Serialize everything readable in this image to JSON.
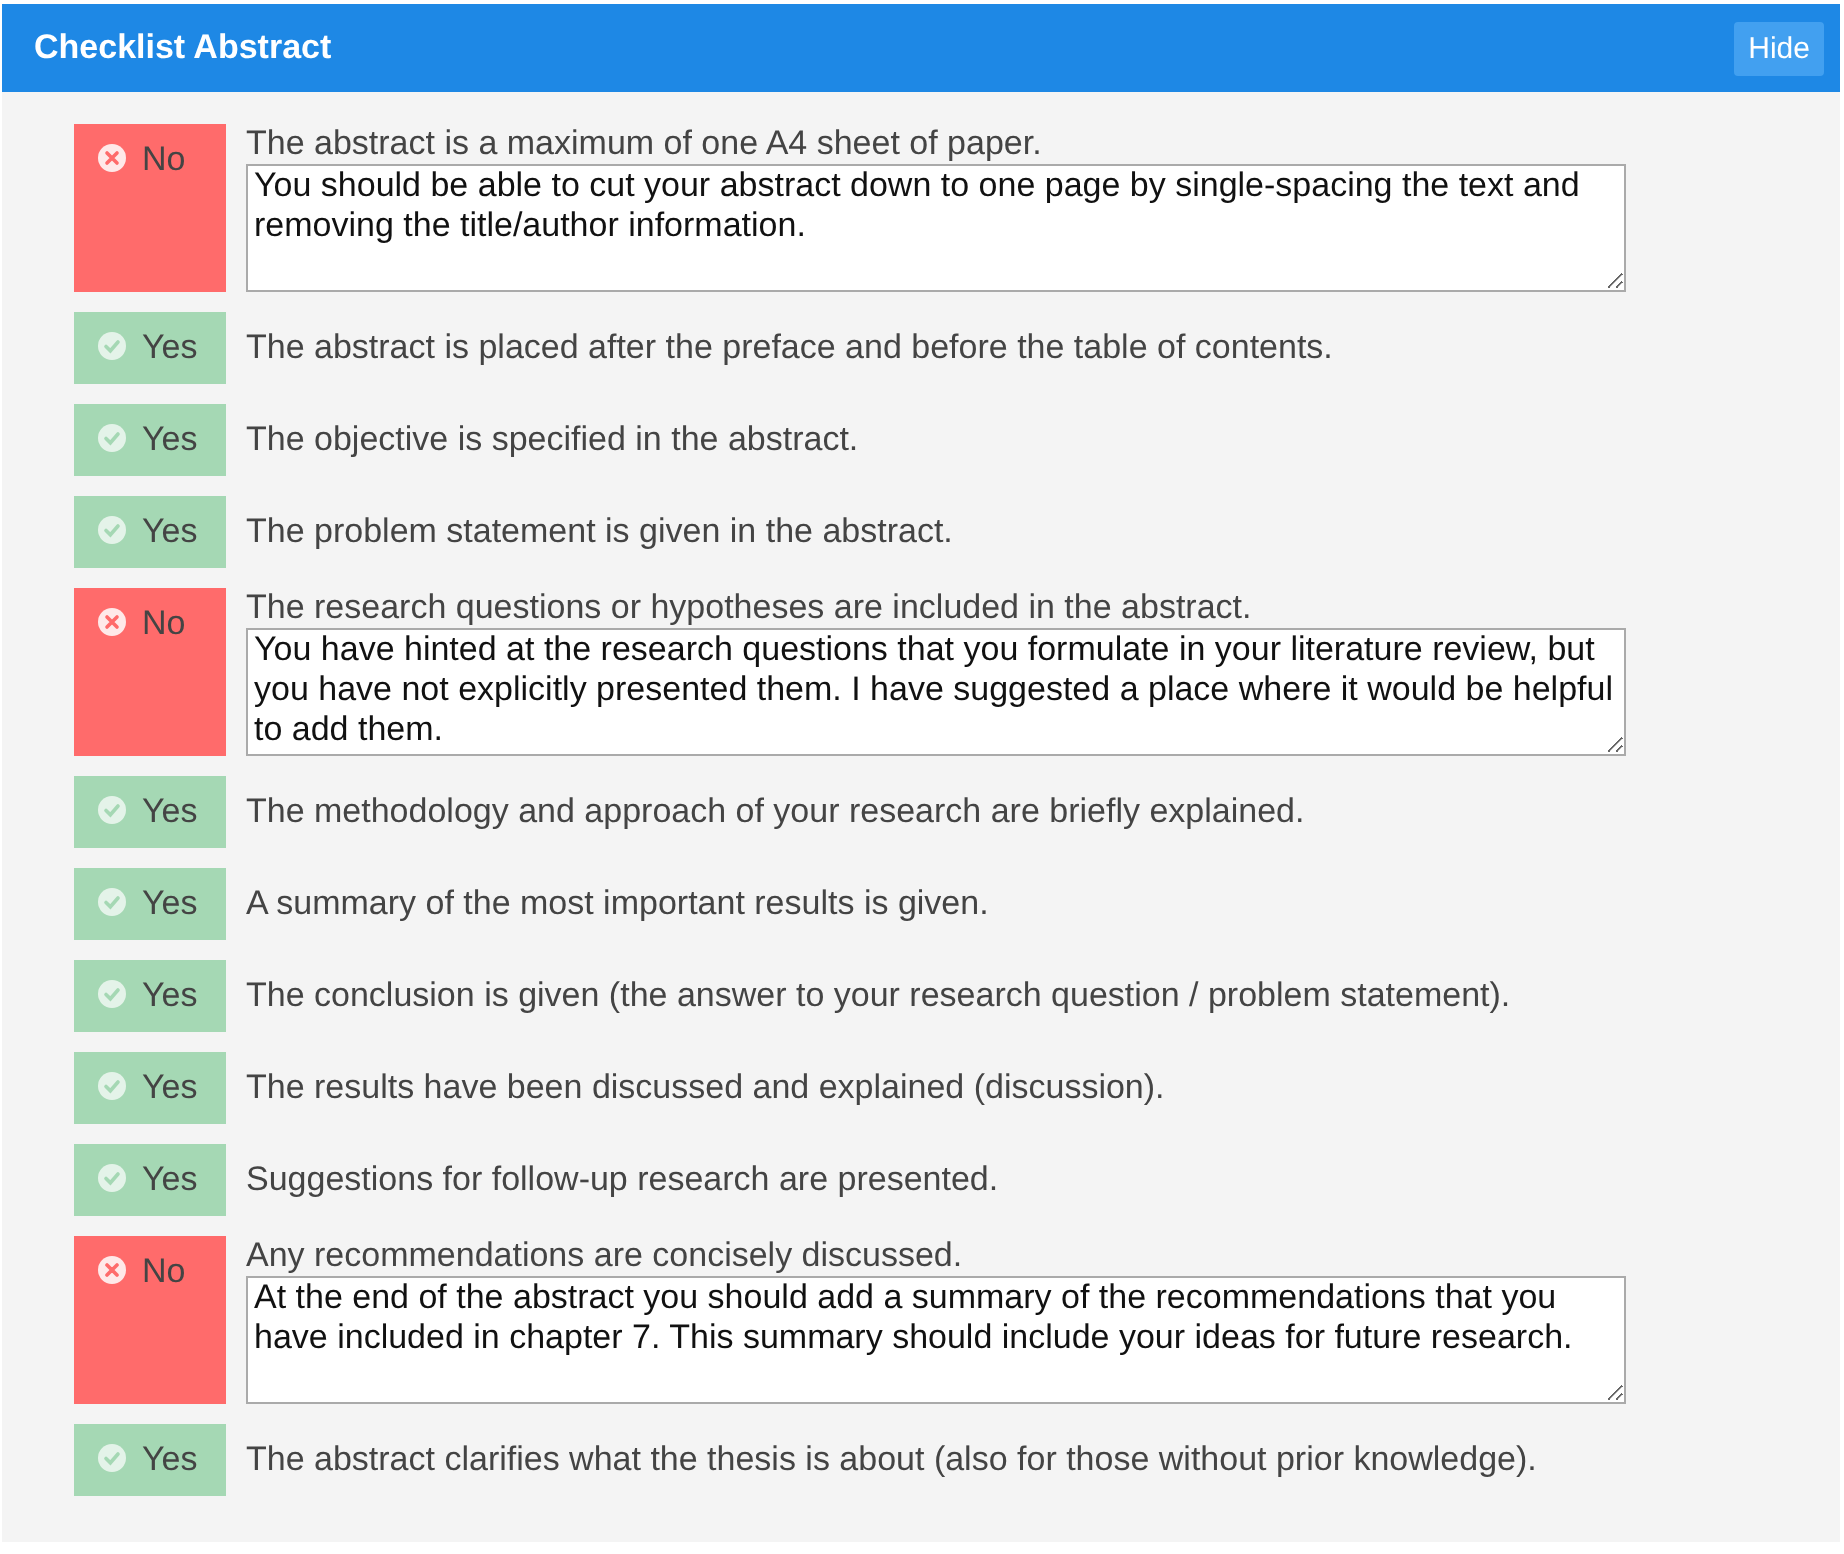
{
  "header": {
    "title": "Checklist Abstract",
    "hide_button": "Hide"
  },
  "items": [
    {
      "kind": "fail",
      "status_label": "No",
      "text": "The abstract is a maximum of one A4 sheet of paper.",
      "comment": "You should be able to cut your abstract down to one page by single-spacing the text and removing the title/author information."
    },
    {
      "kind": "pass",
      "status_label": "Yes",
      "text": "The abstract is placed after the preface and before the table of contents."
    },
    {
      "kind": "pass",
      "status_label": "Yes",
      "text": "The objective is specified in the abstract."
    },
    {
      "kind": "pass",
      "status_label": "Yes",
      "text": "The problem statement is given in the abstract."
    },
    {
      "kind": "fail",
      "status_label": "No",
      "text": "The research questions or hypotheses are included in the abstract.",
      "comment": "You have hinted at the research questions that you formulate in your literature review, but you have not explicitly presented them. I have suggested a place where it would be helpful to add them."
    },
    {
      "kind": "pass",
      "status_label": "Yes",
      "text": "The methodology and approach of your research are briefly explained."
    },
    {
      "kind": "pass",
      "status_label": "Yes",
      "text": "A summary of the most important results is given."
    },
    {
      "kind": "pass",
      "status_label": "Yes",
      "text": "The conclusion is given (the answer to your research question / problem statement)."
    },
    {
      "kind": "pass",
      "status_label": "Yes",
      "text": "The results have been discussed and explained (discussion)."
    },
    {
      "kind": "pass",
      "status_label": "Yes",
      "text": "Suggestions for follow-up research are presented."
    },
    {
      "kind": "fail",
      "status_label": "No",
      "text": "Any recommendations are concisely discussed.",
      "comment": "At the end of the abstract you should add a summary of the recommendations that you have included in chapter 7. This summary should include your ideas for future research."
    },
    {
      "kind": "pass",
      "status_label": "Yes",
      "text": "The abstract clarifies what the thesis is about (also for those without prior knowledge)."
    }
  ]
}
